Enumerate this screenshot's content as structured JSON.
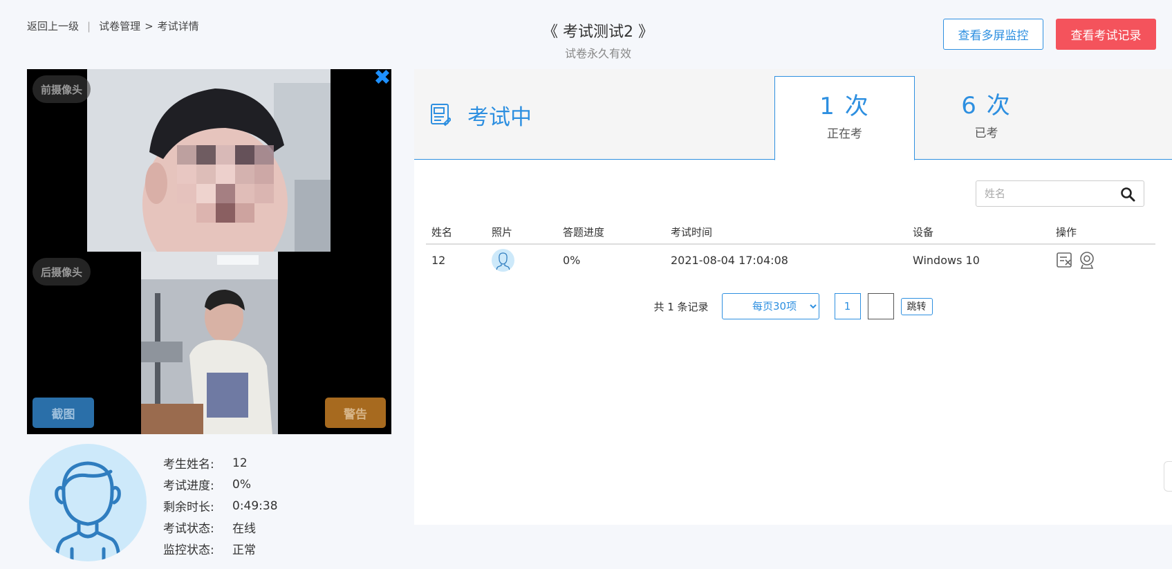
{
  "header": {
    "back_label": "返回上一级",
    "breadcrumb_parent": "试卷管理",
    "breadcrumb_arrow": ">",
    "breadcrumb_current": "考试详情",
    "title": "《 考试测试2 》",
    "subtitle": "试卷永久有效",
    "monitor_button": "查看多屏监控",
    "record_button": "查看考试记录"
  },
  "camera": {
    "front_label": "前摄像头",
    "rear_label": "后摄像头",
    "close_glyph": "✖",
    "screenshot_button": "截图",
    "warn_button": "警告"
  },
  "candidate": {
    "rows": [
      {
        "label": "考生姓名:",
        "value": "12"
      },
      {
        "label": "考试进度:",
        "value": "0%"
      },
      {
        "label": "剩余时长:",
        "value": "0:49:38"
      },
      {
        "label": "考试状态:",
        "value": "在线"
      },
      {
        "label": "监控状态:",
        "value": "正常"
      }
    ]
  },
  "status": {
    "label": "考试中",
    "active_count": "1 次",
    "active_label": "正在考",
    "done_count": "6 次",
    "done_label": "已考"
  },
  "search": {
    "placeholder": "姓名"
  },
  "table": {
    "headers": [
      "姓名",
      "照片",
      "答题进度",
      "考试时间",
      "设备",
      "操作"
    ],
    "rows": [
      {
        "name": "12",
        "progress": "0%",
        "time": "2021-08-04 17:04:08",
        "device": "Windows 10"
      }
    ]
  },
  "pager": {
    "total": "共 1 条记录",
    "page_size": "每页30项",
    "current_page": "1",
    "jump_label": "跳转"
  },
  "icons": {
    "close": "close-icon",
    "status": "exam-paper-icon",
    "search": "search-icon",
    "op1": "force-submit-icon",
    "op2": "webcam-icon"
  },
  "colors": {
    "accent": "#2d8fe0",
    "danger": "#f4535c",
    "screenshot": "#2a6fa9",
    "warn": "#a76a1f",
    "avatar_bg": "#cde9fa"
  }
}
